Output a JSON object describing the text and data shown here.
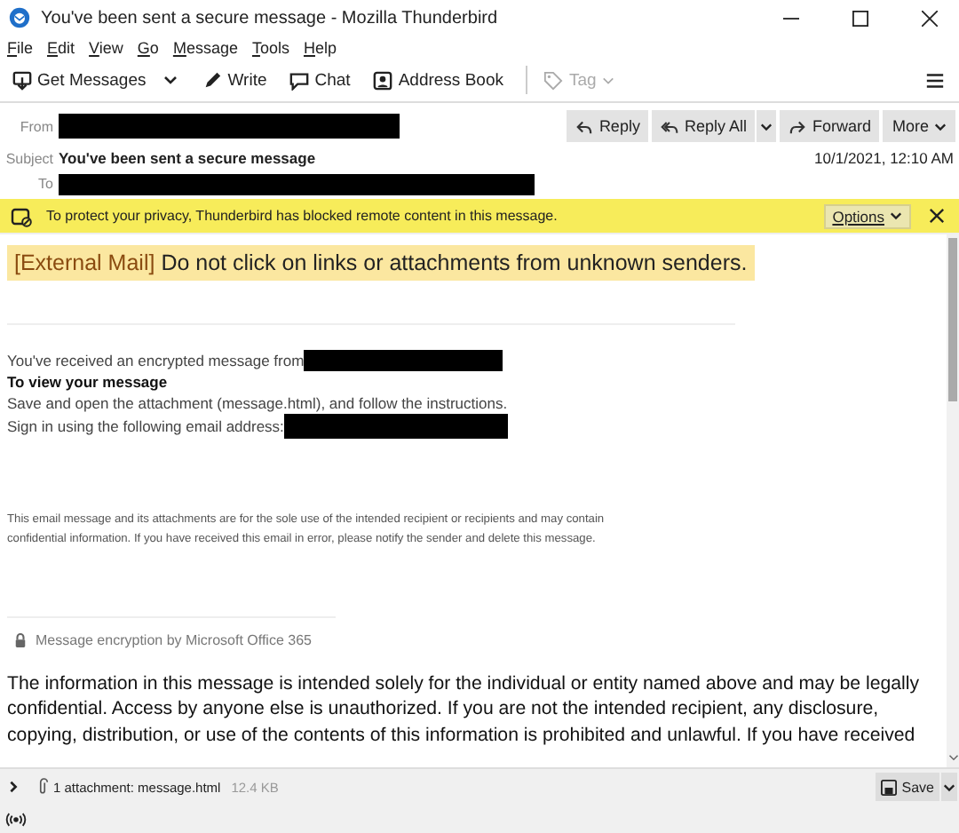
{
  "window": {
    "title": "You've been sent a secure message - Mozilla Thunderbird"
  },
  "menu": [
    "File",
    "Edit",
    "View",
    "Go",
    "Message",
    "Tools",
    "Help"
  ],
  "toolbar": [
    {
      "label": "Get Messages",
      "kind": "get",
      "disabled": false
    },
    {
      "label": "Write",
      "kind": "write",
      "disabled": false
    },
    {
      "label": "Chat",
      "kind": "chat",
      "disabled": false
    },
    {
      "label": "Address Book",
      "kind": "book",
      "disabled": false
    },
    {
      "label": "Tag",
      "kind": "tag",
      "disabled": true
    }
  ],
  "header": {
    "from_label": "From",
    "subject_label": "Subject",
    "subject": "You've been sent a secure message",
    "to_label": "To",
    "date": "10/1/2021, 12:10 AM",
    "actions": [
      {
        "label": "Reply",
        "kind": "reply"
      },
      {
        "label": "Reply All",
        "kind": "replyall"
      },
      {
        "label": "Forward",
        "kind": "forward"
      },
      {
        "label": "More",
        "kind": "more"
      }
    ]
  },
  "notification": {
    "text": "To protect your privacy, Thunderbird has blocked remote content in this message.",
    "options": "Options"
  },
  "banner": {
    "tag": "[External Mail]",
    "text": "Do not click on links or attachments from unknown senders."
  },
  "message": {
    "intro": "You've received an encrypted message from",
    "heading": "To view your message",
    "instruction": "Save and open the attachment (message.html), and follow the instructions.",
    "sign_in": "Sign in using the following email address:",
    "disclaimer": [
      "This email message and its attachments are for the sole use of the intended recipient or recipients and may contain",
      "confidential information. If you have received this email in error, please notify the sender and delete this message."
    ],
    "encryption": "Message encryption by Microsoft Office 365",
    "notice": [
      "The information in this message is intended solely for the individual or entity named above and may be legally",
      "confidential. Access by anyone else is unauthorized. If you are not the intended recipient, any disclosure,",
      "copying, distribution, or use of the contents of this information is prohibited and unlawful. If you have received"
    ]
  },
  "attachment": {
    "summary": "1 attachment: message.html",
    "size": "12.4 KB",
    "save": "Save"
  }
}
